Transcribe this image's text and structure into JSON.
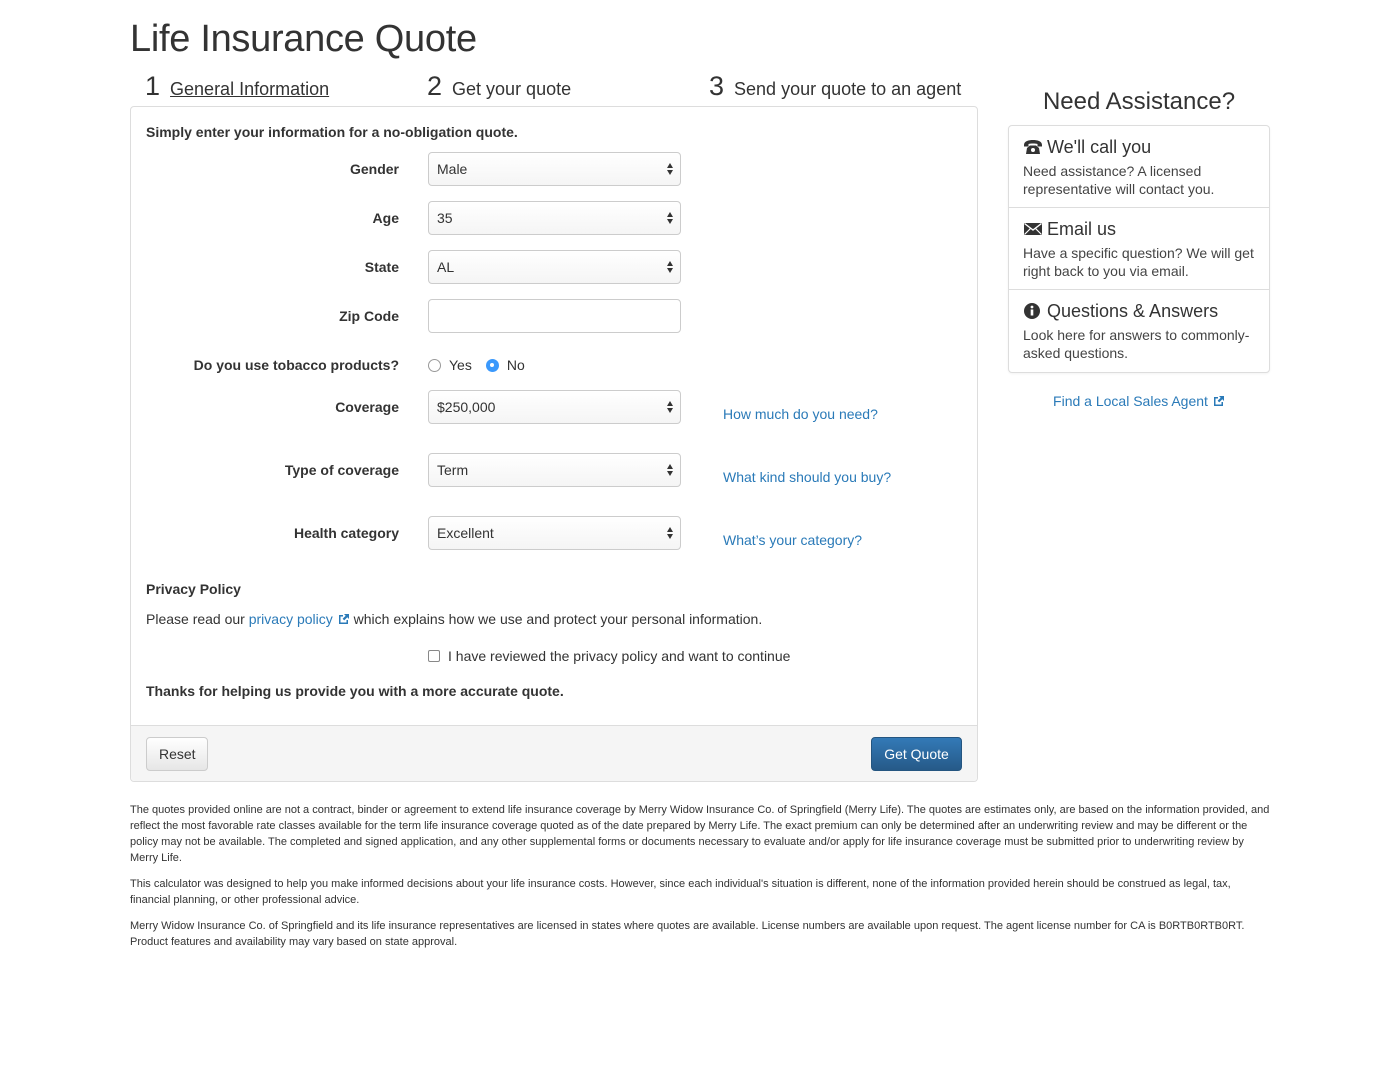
{
  "page": {
    "title": "Life Insurance Quote"
  },
  "steps": [
    {
      "num": "1",
      "label": "General Information"
    },
    {
      "num": "2",
      "label": "Get your quote"
    },
    {
      "num": "3",
      "label": "Send your quote to an agent"
    }
  ],
  "form": {
    "intro": "Simply enter your information for a no-obligation quote.",
    "gender": {
      "label": "Gender",
      "value": "Male"
    },
    "age": {
      "label": "Age",
      "value": "35"
    },
    "state": {
      "label": "State",
      "value": "AL"
    },
    "zip": {
      "label": "Zip Code",
      "value": "",
      "placeholder": ""
    },
    "tobacco": {
      "label": "Do you use tobacco products?",
      "yes_label": "Yes",
      "no_label": "No",
      "selected": "No"
    },
    "coverage": {
      "label": "Coverage",
      "value": "$250,000",
      "help": "How much do you need?"
    },
    "coverage_type": {
      "label": "Type of coverage",
      "value": "Term",
      "help": "What kind should you buy?"
    },
    "health": {
      "label": "Health category",
      "value": "Excellent",
      "help": "What’s your category?"
    },
    "privacy": {
      "title": "Privacy Policy",
      "text_before": "Please read our ",
      "link": "privacy policy",
      "text_after": " which explains how we use and protect your personal information.",
      "checkbox_label": "I have reviewed the privacy policy and want to continue",
      "checked": false
    },
    "thanks": "Thanks for helping us provide you with a more accurate quote.",
    "reset_label": "Reset",
    "submit_label": "Get Quote"
  },
  "assistance": {
    "title": "Need Assistance?",
    "items": [
      {
        "icon": "phone-icon",
        "title": "We'll call you",
        "desc": "Need assistance? A licensed representative will contact you."
      },
      {
        "icon": "envelope-icon",
        "title": "Email us",
        "desc": "Have a specific question? We will get right back to you via email."
      },
      {
        "icon": "info-icon",
        "title": "Questions & Answers",
        "desc": "Look here for answers to commonly-asked questions."
      }
    ],
    "local_agent": "Find a Local Sales Agent"
  },
  "disclaimer": [
    "The quotes provided online are not a contract, binder or agreement to extend life insurance coverage by Merry Widow Insurance Co. of Springfield (Merry Life). The quotes are estimates only, are based on the information provided, and reflect the most favorable rate classes available for the term life insurance coverage quoted as of the date prepared by Merry Life. The exact premium can only be determined after an underwriting review and may be different or the policy may not be available. The completed and signed application, and any other supplemental forms or documents necessary to evaluate and/or apply for life insurance coverage must be submitted prior to underwriting review by Merry Life.",
    "This calculator was designed to help you make informed decisions about your life insurance costs. However, since each individual's situation is different, none of the information provided herein should be construed as legal, tax, financial planning, or other professional advice.",
    "Merry Widow Insurance Co. of Springfield and its life insurance representatives are licensed in states where quotes are available. License numbers are available upon request. The agent license number for CA is B0RTB0RTB0RT. Product features and availability may vary based on state approval."
  ],
  "colors": {
    "link": "#2a7ab8",
    "primary_button": "#2d6ca2",
    "radio_checked": "#3b99fc",
    "panel_border": "#dddddd",
    "footer_bg": "#f5f5f5"
  }
}
